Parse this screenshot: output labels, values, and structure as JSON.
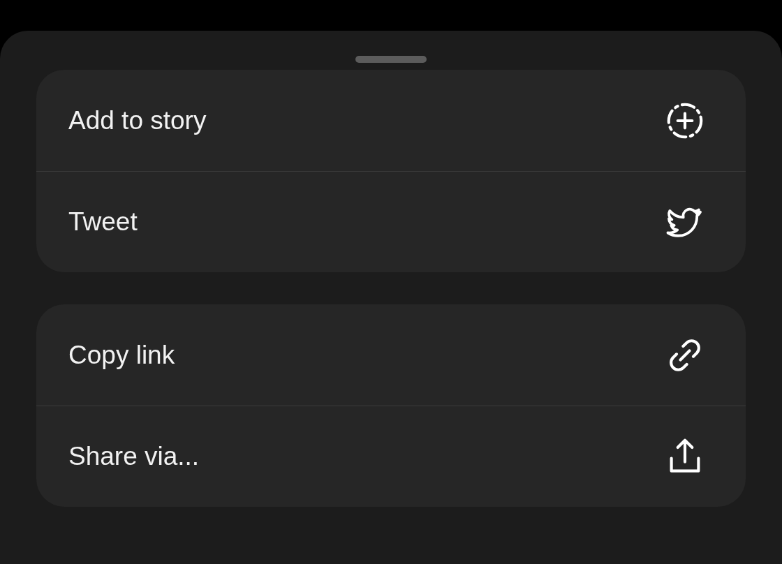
{
  "groups": [
    {
      "items": [
        {
          "label": "Add to story",
          "kind": "story"
        },
        {
          "label": "Tweet",
          "kind": "tweet"
        }
      ]
    },
    {
      "items": [
        {
          "label": "Copy link",
          "kind": "link"
        },
        {
          "label": "Share via...",
          "kind": "share"
        }
      ]
    }
  ]
}
